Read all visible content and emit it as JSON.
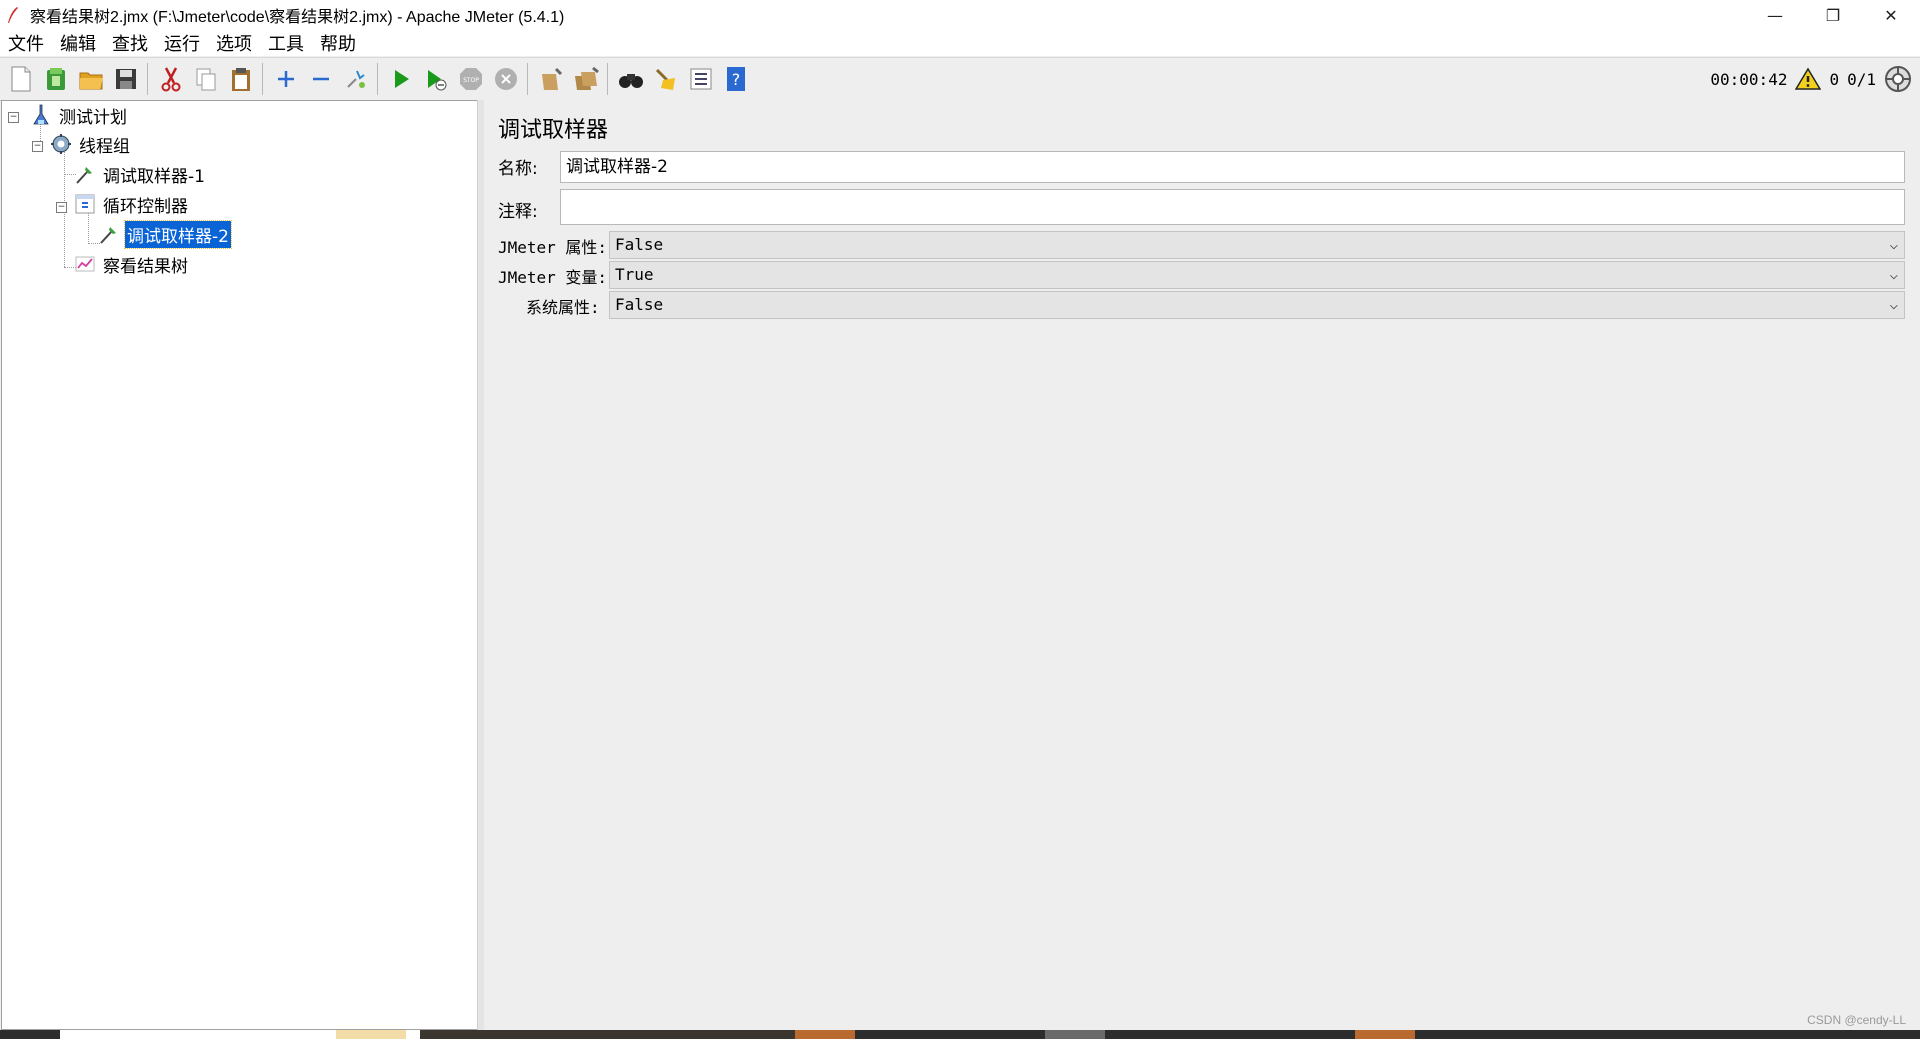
{
  "window": {
    "title": "察看结果树2.jmx (F:\\Jmeter\\code\\察看结果树2.jmx) - Apache JMeter (5.4.1)",
    "minimize_glyph": "—",
    "restore_glyph": "❐",
    "close_glyph": "✕"
  },
  "menu": [
    "文件",
    "编辑",
    "查找",
    "运行",
    "选项",
    "工具",
    "帮助"
  ],
  "toolbar": {
    "timer": "00:00:42",
    "warning_count": "0",
    "threads": "0/1"
  },
  "tree": {
    "items": [
      {
        "label": "测试计划",
        "icon": "test-plan-icon"
      },
      {
        "label": "线程组",
        "icon": "thread-group-icon"
      },
      {
        "label": "调试取样器-1",
        "icon": "sampler-icon"
      },
      {
        "label": "循环控制器",
        "icon": "loop-controller-icon"
      },
      {
        "label": "调试取样器-2",
        "icon": "sampler-icon",
        "selected": true
      },
      {
        "label": "察看结果树",
        "icon": "result-tree-icon"
      }
    ]
  },
  "panel": {
    "title": "调试取样器",
    "name_label": "名称:",
    "name_value": "调试取样器-2",
    "comment_label": "注释:",
    "comment_value": "",
    "jmeter_props_label": "JMeter 属性:",
    "jmeter_props_value": "False",
    "jmeter_vars_label": "JMeter 变量:",
    "jmeter_vars_value": "True",
    "system_props_label": "系统属性:",
    "system_props_value": "False"
  },
  "watermark": "CSDN @cendy-LL",
  "colors": {
    "selection": "#0a64d6",
    "run_green": "#1a9a1a"
  }
}
